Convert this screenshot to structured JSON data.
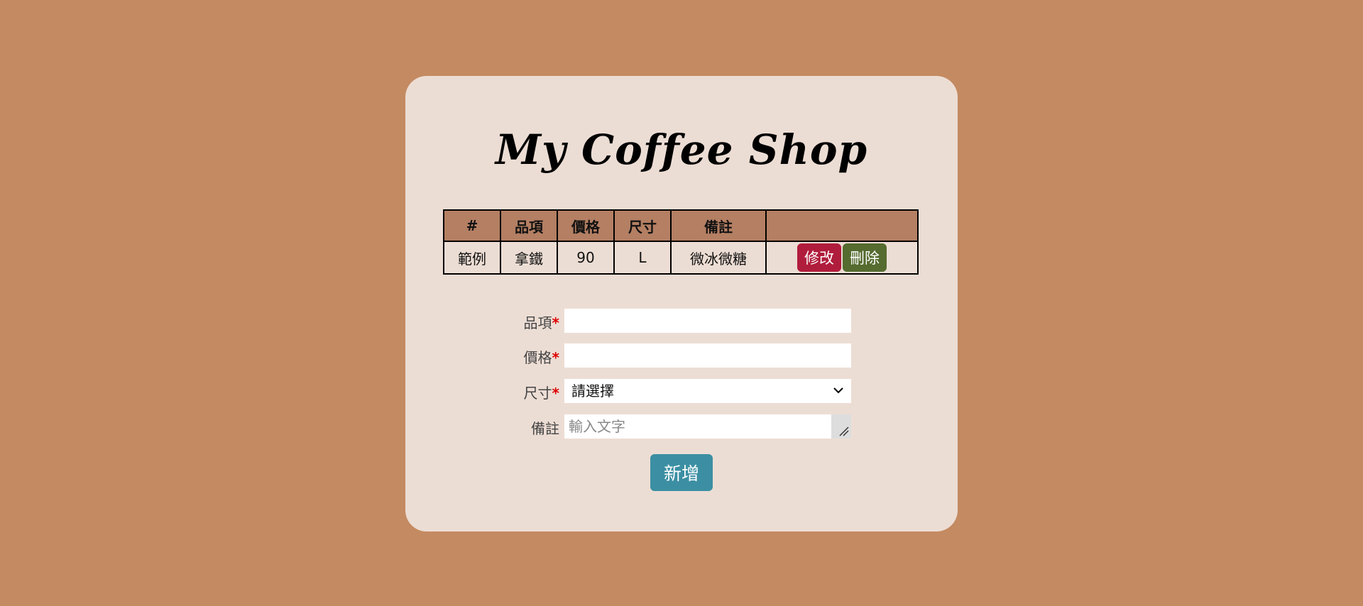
{
  "title": "My Coffee Shop",
  "table": {
    "headers": [
      "#",
      "品項",
      "價格",
      "尺寸",
      "備註",
      ""
    ],
    "rows": [
      {
        "id": "範例",
        "item": "拿鐵",
        "price": "90",
        "size": "L",
        "note": "微冰微糖",
        "edit_label": "修改",
        "delete_label": "刪除"
      }
    ]
  },
  "form": {
    "item_label": "品項",
    "price_label": "價格",
    "size_label": "尺寸",
    "note_label": "備註",
    "required_mark": "*",
    "size_selected": "請選擇",
    "note_placeholder": "輸入文字",
    "submit_label": "新增"
  },
  "colors": {
    "background": "#c48a61",
    "card": "#ecddd4",
    "header": "#b47f63",
    "edit": "#b01c3c",
    "delete": "#556b2f",
    "submit": "#3c8fa3"
  }
}
